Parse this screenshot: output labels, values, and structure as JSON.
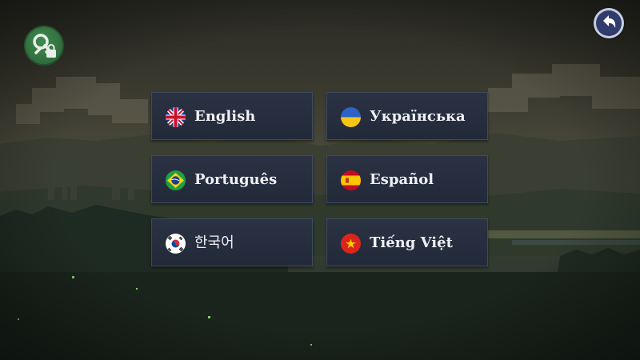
{
  "icons": {
    "key_lock": "key-lock-icon",
    "back": "back-arrow-icon"
  },
  "languages": [
    {
      "label": "English",
      "flag": "uk-flag-icon"
    },
    {
      "label": "Українська",
      "flag": "ukraine-flag-icon"
    },
    {
      "label": "Português",
      "flag": "brazil-flag-icon"
    },
    {
      "label": "Español",
      "flag": "spain-flag-icon"
    },
    {
      "label": "한국어",
      "flag": "korea-flag-icon"
    },
    {
      "label": "Tiếng Việt",
      "flag": "vietnam-flag-icon"
    }
  ],
  "colors": {
    "button_bg": "#242c3d",
    "text": "#eef0f5",
    "key_button": "#347a45",
    "back_button": "#2f3c6c"
  }
}
